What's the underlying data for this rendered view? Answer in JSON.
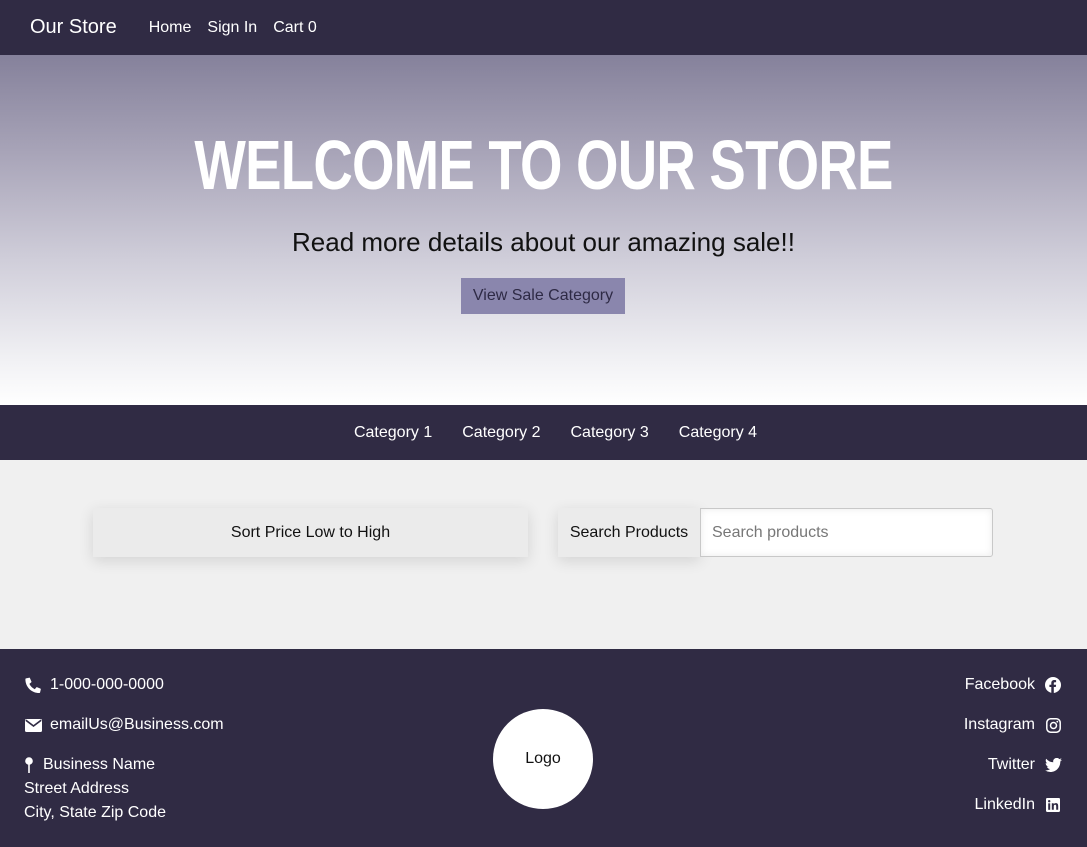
{
  "nav": {
    "brand": "Our Store",
    "links": [
      "Home",
      "Sign In",
      "Cart 0"
    ]
  },
  "hero": {
    "title": "WELCOME TO OUR STORE",
    "subtitle": "Read more details about our amazing sale!!",
    "button_label": "View Sale Category"
  },
  "categories": [
    "Category 1",
    "Category 2",
    "Category 3",
    "Category 4"
  ],
  "controls": {
    "sort_label": "Sort Price Low to High",
    "search_label": "Search Products",
    "search_placeholder": "Search products"
  },
  "footer": {
    "phone": "1-000-000-0000",
    "email": "emailUs@Business.com",
    "address": [
      "Business Name",
      "Street Address",
      "City, State Zip Code"
    ],
    "logo": "Logo",
    "social": [
      "Facebook",
      "Instagram",
      "Twitter",
      "LinkedIn"
    ]
  },
  "colors": {
    "nav_bg": "#302b44",
    "accent_button": "#8a86ad"
  },
  "icons": {
    "phone": "phone-icon",
    "email": "envelope-icon",
    "address": "map-pin-icon",
    "facebook": "facebook-icon",
    "instagram": "instagram-icon",
    "twitter": "twitter-icon",
    "linkedin": "linkedin-icon"
  }
}
